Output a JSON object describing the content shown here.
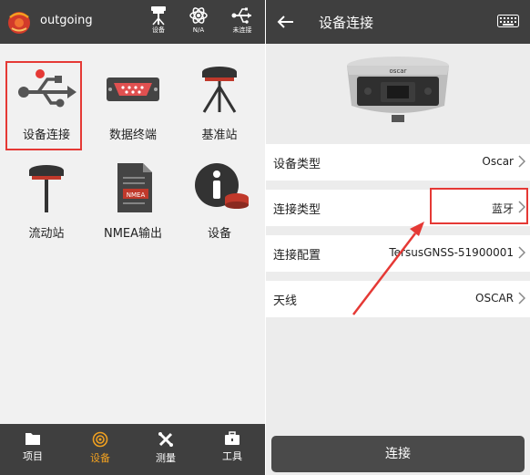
{
  "left": {
    "project_name": "outgoing",
    "header_icons": [
      {
        "label": "设备",
        "icon": "gnss-receiver-icon"
      },
      {
        "label": "N/A",
        "icon": "satellite-atom-icon"
      },
      {
        "label": "未连接",
        "icon": "usb-icon"
      }
    ],
    "grid": [
      {
        "label": "设备连接",
        "icon": "usb-icon"
      },
      {
        "label": "数据终端",
        "icon": "serial-port-icon"
      },
      {
        "label": "基准站",
        "icon": "base-station-icon"
      },
      {
        "label": "流动站",
        "icon": "rover-icon"
      },
      {
        "label": "NMEA输出",
        "icon": "nmea-file-icon"
      },
      {
        "label": "设备",
        "icon": "device-info-icon"
      }
    ],
    "nmea_badge": "NMEA",
    "bottom_nav": [
      {
        "label": "项目",
        "icon": "folder-icon"
      },
      {
        "label": "设备",
        "icon": "device-icon"
      },
      {
        "label": "测量",
        "icon": "measure-icon"
      },
      {
        "label": "工具",
        "icon": "toolbox-icon"
      }
    ]
  },
  "right": {
    "title": "设备连接",
    "device_brand": "oscar",
    "rows": [
      {
        "label": "设备类型",
        "value": "Oscar"
      },
      {
        "label": "连接类型",
        "value": "蓝牙"
      },
      {
        "label": "连接配置",
        "value": "TersusGNSS-51900001"
      },
      {
        "label": "天线",
        "value": "OSCAR"
      }
    ],
    "connect_label": "连接"
  },
  "colors": {
    "header_bg": "#3f3f3f",
    "accent_active": "#f0a020",
    "highlight_red": "#e53935"
  }
}
